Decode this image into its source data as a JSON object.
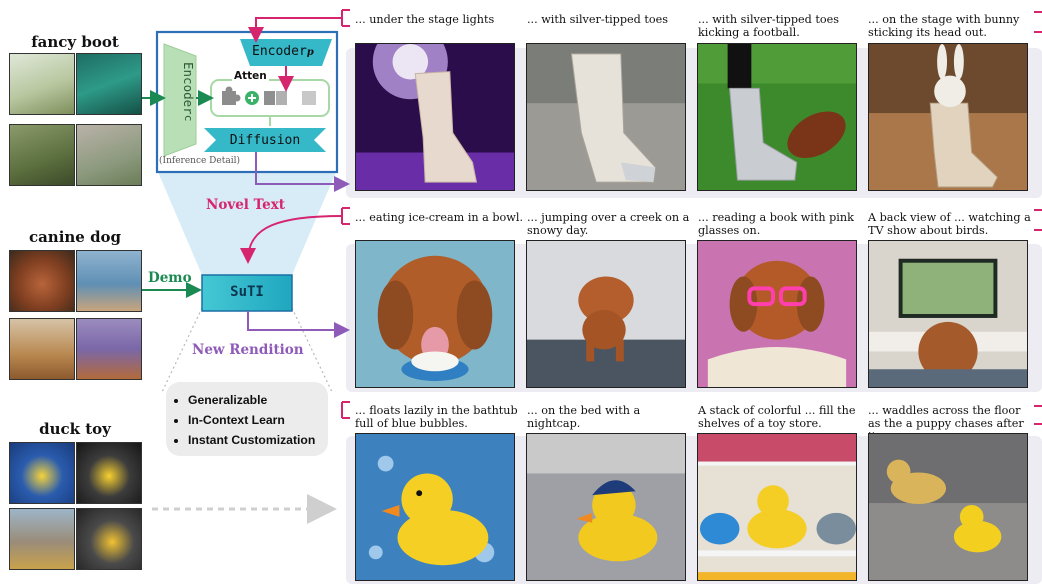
{
  "subjects": [
    {
      "title": "fancy boot"
    },
    {
      "title": "canine dog"
    },
    {
      "title": "duck toy"
    }
  ],
  "diagram": {
    "encoder_p": "Encoder",
    "encoder_p_sub": "p",
    "encoder_c": "Encoder",
    "encoder_c_sub": "c",
    "atten": "Atten",
    "diffusion": "Diffusion",
    "inference_detail": "(Inference Detail)",
    "novel_text": "Novel Text",
    "demo": "Demo",
    "suti": "SuTI",
    "new_rendition": "New Rendition",
    "bullets": [
      "Generalizable",
      "In-Context Learn",
      "Instant Customization"
    ]
  },
  "rows": [
    {
      "captions": [
        "... under the stage lights",
        "... with silver-tipped toes",
        "... with silver-tipped toes kicking a football.",
        "... on the stage with bunny sticking its head out."
      ]
    },
    {
      "captions": [
        "... eating ice-cream in a bowl.",
        "... jumping over a creek on a snowy day.",
        "... reading a book with pink glasses on.",
        "A back view of ... watching a TV show about birds."
      ]
    },
    {
      "captions": [
        "... floats lazily in the bathtub full of blue bubbles.",
        "... on the bed with a nightcap.",
        "A stack of colorful ... fill the shelves of a toy store.",
        "... waddles across the floor as the a puppy chases after it."
      ]
    }
  ],
  "colors": {
    "magenta": "#d6246e",
    "purple": "#8e5bb8",
    "green": "#1a8a52",
    "teal": "#35b9c9",
    "panel_blue": "#2d6fb6"
  }
}
